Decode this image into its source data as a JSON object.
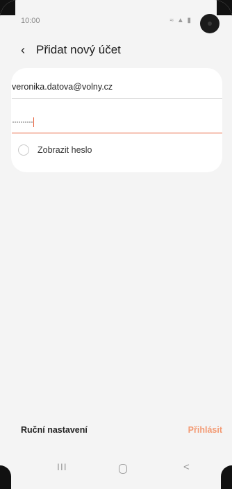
{
  "status_bar": {
    "time": "10:00",
    "icons": "≈ ▲ ▮"
  },
  "header": {
    "back_icon": "‹",
    "title": "Přidat nový účet"
  },
  "form": {
    "email_value": "veronika.datova@volny.cz",
    "password_dots": "··········",
    "show_password_label": "Zobrazit heslo"
  },
  "footer": {
    "manual_setup": "Ruční nastavení",
    "sign_in": "Přihlásit"
  },
  "nav": {
    "recent": "III",
    "back": "<"
  },
  "colors": {
    "accent": "#e65c36",
    "signin": "#f39a73",
    "background": "#f4f4f4"
  }
}
